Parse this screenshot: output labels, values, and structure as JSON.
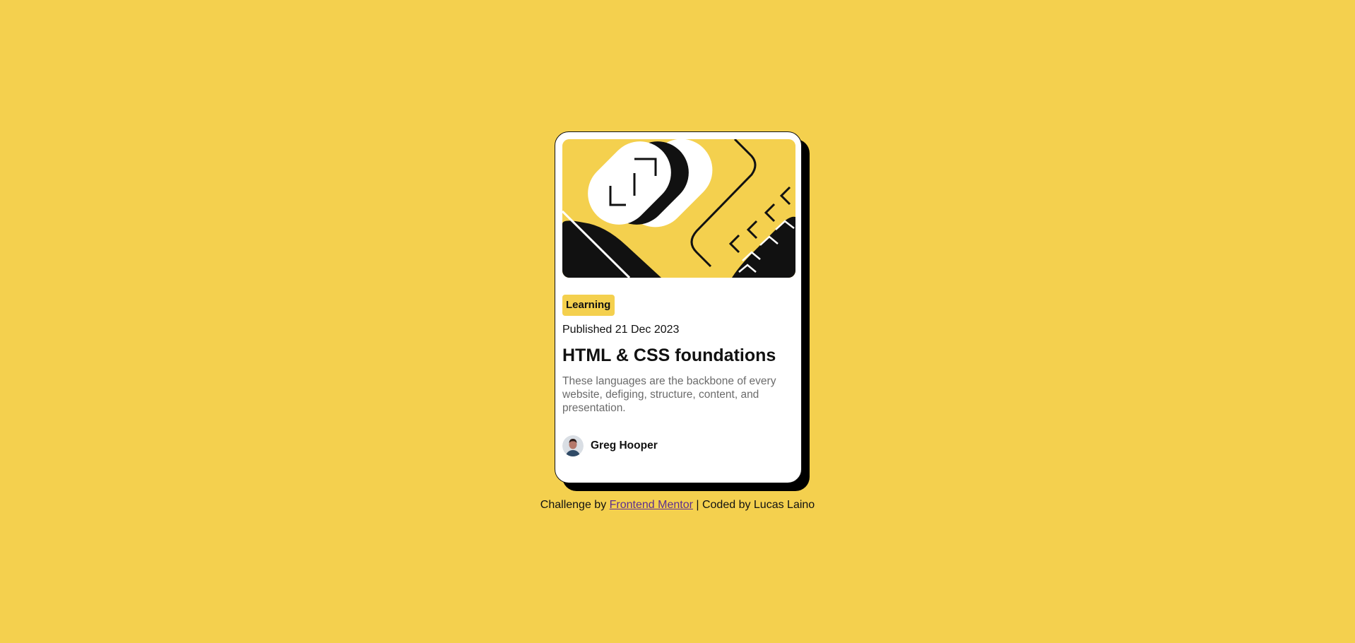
{
  "colors": {
    "page_background": "#F4D04E",
    "card_background": "#FFFFFF",
    "card_shadow": "#000000",
    "tag_background": "#F4D04E",
    "text_primary": "#111111",
    "text_secondary": "#6B6B6B",
    "link": "#5C2D91"
  },
  "card": {
    "image_icon": "illustration-article-image",
    "tag": "Learning",
    "published": "Published 21 Dec 2023",
    "title": "HTML & CSS foundations",
    "description": "These languages are the backbone of every website, defiging, structure, content, and presentation.",
    "author": {
      "avatar_icon": "greg-hooper-avatar",
      "name": "Greg Hooper"
    }
  },
  "footer": {
    "prefix": "Challenge by ",
    "link_text": "Frontend Mentor",
    "suffix": " | Coded by Lucas Laino"
  }
}
